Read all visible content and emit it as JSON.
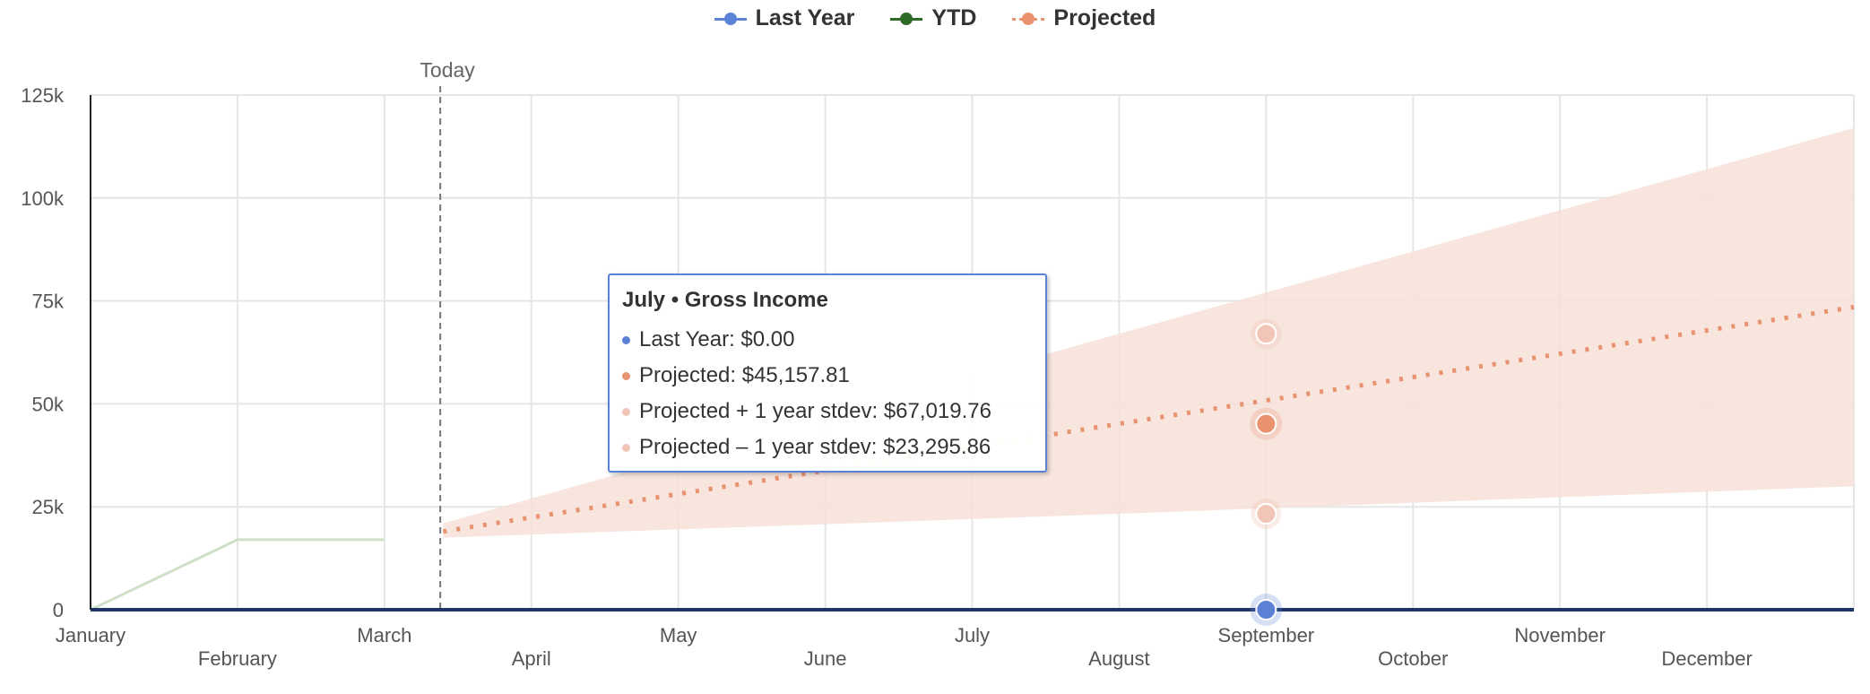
{
  "legend": [
    {
      "name": "Last Year",
      "color": "#5b82d6",
      "style": "line-dot"
    },
    {
      "name": "YTD",
      "color": "#2e6b27",
      "style": "line-dot"
    },
    {
      "name": "Projected",
      "color": "#e8926f",
      "style": "dotted-dot"
    }
  ],
  "chart_data": {
    "type": "line",
    "x_labels_row1": [
      "January",
      "March",
      "May",
      "July",
      "September",
      "November"
    ],
    "x_labels_row2": [
      "February",
      "April",
      "June",
      "August",
      "October",
      "December"
    ],
    "categories": [
      "January",
      "February",
      "March",
      "April",
      "May",
      "June",
      "July",
      "August",
      "September",
      "October",
      "November",
      "December"
    ],
    "yticks": [
      0,
      25000,
      50000,
      75000,
      100000,
      125000
    ],
    "ytick_labels": [
      "0",
      "25k",
      "50k",
      "75k",
      "100k",
      "125k"
    ],
    "ylim": [
      0,
      125000
    ],
    "grid": true,
    "today_marker": {
      "label": "Today",
      "x": 2.38
    },
    "series": [
      {
        "name": "Last Year",
        "color": "#5b82d6",
        "points": [
          [
            0,
            0
          ],
          [
            1,
            0
          ],
          [
            2,
            0
          ],
          [
            3,
            0
          ],
          [
            4,
            0
          ],
          [
            5,
            0
          ],
          [
            6,
            0
          ],
          [
            7,
            0
          ],
          [
            8,
            0
          ],
          [
            9,
            0
          ],
          [
            10,
            0
          ],
          [
            11,
            0
          ],
          [
            12,
            0
          ]
        ]
      },
      {
        "name": "YTD",
        "color": "#cfe0c9",
        "points": [
          [
            0,
            0
          ],
          [
            1,
            17000
          ],
          [
            2,
            17000
          ]
        ]
      },
      {
        "name": "Projected",
        "color": "#e8926f",
        "points": [
          [
            2.4,
            19000
          ],
          [
            7,
            45157.81
          ],
          [
            12,
            73500
          ]
        ]
      }
    ],
    "band": {
      "color": "#f6e0d8",
      "upper": [
        [
          2.4,
          21000
        ],
        [
          7,
          67019.76
        ],
        [
          12,
          117000
        ]
      ],
      "lower": [
        [
          2.4,
          17500
        ],
        [
          7,
          23295.86
        ],
        [
          12,
          30000
        ]
      ]
    },
    "hover": {
      "x": 7,
      "last_year": 0,
      "projected": 45157.81,
      "upper": 67019.76,
      "lower": 23295.86
    }
  },
  "tooltip": {
    "title": "July • Gross Income",
    "rows": [
      {
        "color": "#5b82d6",
        "text": "Last Year: $0.00"
      },
      {
        "color": "#e8926f",
        "text": "Projected: $45,157.81"
      },
      {
        "color": "#f1c6b7",
        "text": "Projected + 1 year stdev: $67,019.76"
      },
      {
        "color": "#f1c6b7",
        "text": "Projected – 1 year stdev: $23,295.86"
      }
    ]
  }
}
